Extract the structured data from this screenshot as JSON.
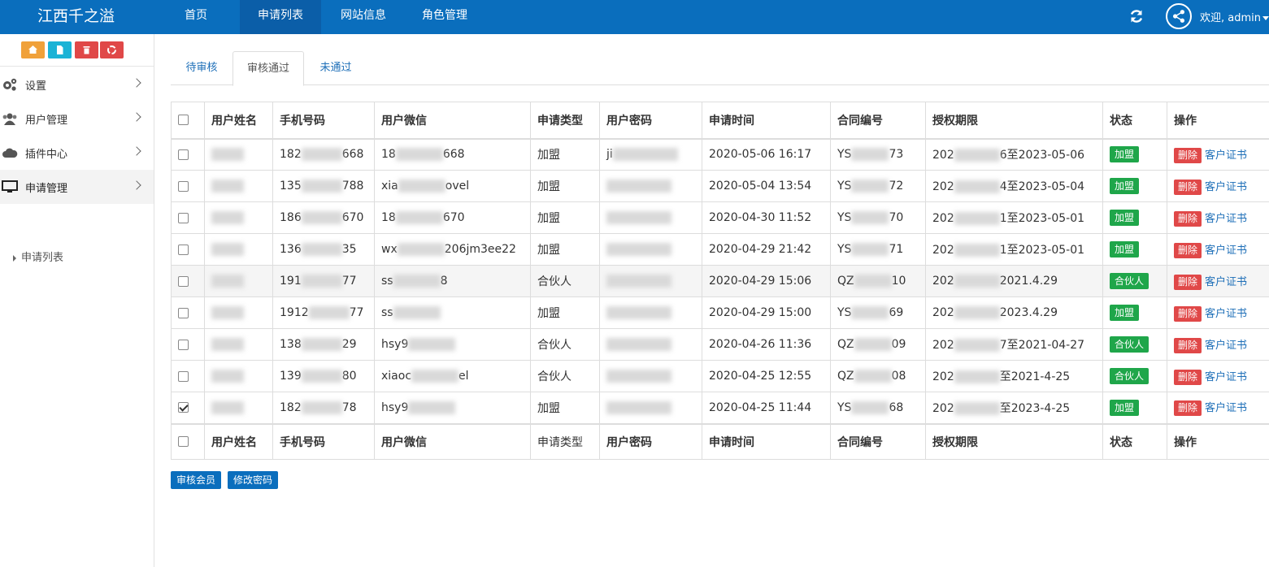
{
  "brand": "江西千之溢",
  "nav": [
    "首页",
    "申请列表",
    "网站信息",
    "角色管理"
  ],
  "user": {
    "welcome": "欢迎, admin"
  },
  "shortcuts": [
    {
      "icon": "home-icon",
      "color": "#f0a13a"
    },
    {
      "icon": "file-icon",
      "color": "#1bb3d6"
    },
    {
      "icon": "trash-icon",
      "color": "#e04848"
    },
    {
      "icon": "recycle-icon",
      "color": "#e04848"
    }
  ],
  "sidebar": {
    "items": [
      {
        "label": "设置",
        "icon": "gears-icon"
      },
      {
        "label": "用户管理",
        "icon": "users-icon"
      },
      {
        "label": "插件中心",
        "icon": "cloud-icon"
      },
      {
        "label": "申请管理",
        "icon": "desktop-icon"
      }
    ],
    "sub_item": "申请列表"
  },
  "tabs": [
    "待审核",
    "审核通过",
    "未通过"
  ],
  "table": {
    "headers": [
      "用户姓名",
      "手机号码",
      "用户微信",
      "申请类型",
      "用户密码",
      "申请时间",
      "合同编号",
      "授权期限",
      "状态",
      "操作"
    ],
    "delete_label": "删除",
    "cert_label": "客户证书",
    "rows": [
      {
        "phone_a": "182",
        "phone_b": "668",
        "wx_a": "18",
        "wx_b": "668",
        "type": "加盟",
        "pwd_a": "ji",
        "time": "2020-05-06 16:17",
        "contract_a": "YS",
        "contract_b": "73",
        "term_a": "202",
        "term_b": "6至2023-05-06",
        "status": "加盟",
        "checked": false
      },
      {
        "phone_a": "135",
        "phone_b": "788",
        "wx_a": "xia",
        "wx_b": "ovel",
        "type": "加盟",
        "pwd_a": "",
        "time": "2020-05-04 13:54",
        "contract_a": "YS",
        "contract_b": "72",
        "term_a": "202",
        "term_b": "4至2023-05-04",
        "status": "加盟",
        "checked": false
      },
      {
        "phone_a": "186",
        "phone_b": "670",
        "wx_a": "18",
        "wx_b": "670",
        "type": "加盟",
        "pwd_a": "",
        "time": "2020-04-30 11:52",
        "contract_a": "YS",
        "contract_b": "70",
        "term_a": "202",
        "term_b": "1至2023-05-01",
        "status": "加盟",
        "checked": false
      },
      {
        "phone_a": "136",
        "phone_b": "35",
        "wx_a": "wx",
        "wx_b": "206jm3ee22",
        "type": "加盟",
        "pwd_a": "",
        "time": "2020-04-29 21:42",
        "contract_a": "YS",
        "contract_b": "71",
        "term_a": "202",
        "term_b": "1至2023-05-01",
        "status": "加盟",
        "checked": false
      },
      {
        "phone_a": "191",
        "phone_b": "77",
        "wx_a": "ss",
        "wx_b": "8",
        "type": "合伙人",
        "pwd_a": "",
        "time": "2020-04-29 15:06",
        "contract_a": "QZ",
        "contract_b": "10",
        "term_a": "202",
        "term_b": "2021.4.29",
        "status": "合伙人",
        "checked": false
      },
      {
        "phone_a": "1912",
        "phone_b": "77",
        "wx_a": "ss",
        "wx_b": "",
        "type": "加盟",
        "pwd_a": "",
        "time": "2020-04-29 15:00",
        "contract_a": "YS",
        "contract_b": "69",
        "term_a": "202",
        "term_b": "2023.4.29",
        "status": "加盟",
        "checked": false
      },
      {
        "phone_a": "138",
        "phone_b": "29",
        "wx_a": "hsy9",
        "wx_b": "",
        "type": "合伙人",
        "pwd_a": "",
        "time": "2020-04-26 11:36",
        "contract_a": "QZ",
        "contract_b": "09",
        "term_a": "202",
        "term_b": "7至2021-04-27",
        "status": "合伙人",
        "checked": false
      },
      {
        "phone_a": "139",
        "phone_b": "80",
        "wx_a": "xiaoc",
        "wx_b": "el",
        "type": "合伙人",
        "pwd_a": "",
        "time": "2020-04-25 12:55",
        "contract_a": "QZ",
        "contract_b": "08",
        "term_a": "202",
        "term_b": "至2021-4-25",
        "status": "合伙人",
        "checked": false
      },
      {
        "phone_a": "182",
        "phone_b": "78",
        "wx_a": "hsy9",
        "wx_b": "",
        "type": "加盟",
        "pwd_a": "",
        "time": "2020-04-25 11:44",
        "contract_a": "YS",
        "contract_b": "68",
        "term_a": "202",
        "term_b": "至2023-4-25",
        "status": "加盟",
        "checked": true
      }
    ]
  },
  "buttons": {
    "approve": "审核会员",
    "change_pwd": "修改密码"
  },
  "colors": {
    "nav_bg": "#0a6ebd",
    "status_green": "#1fa64a",
    "danger": "#e04848",
    "link": "#1e6fb8"
  }
}
